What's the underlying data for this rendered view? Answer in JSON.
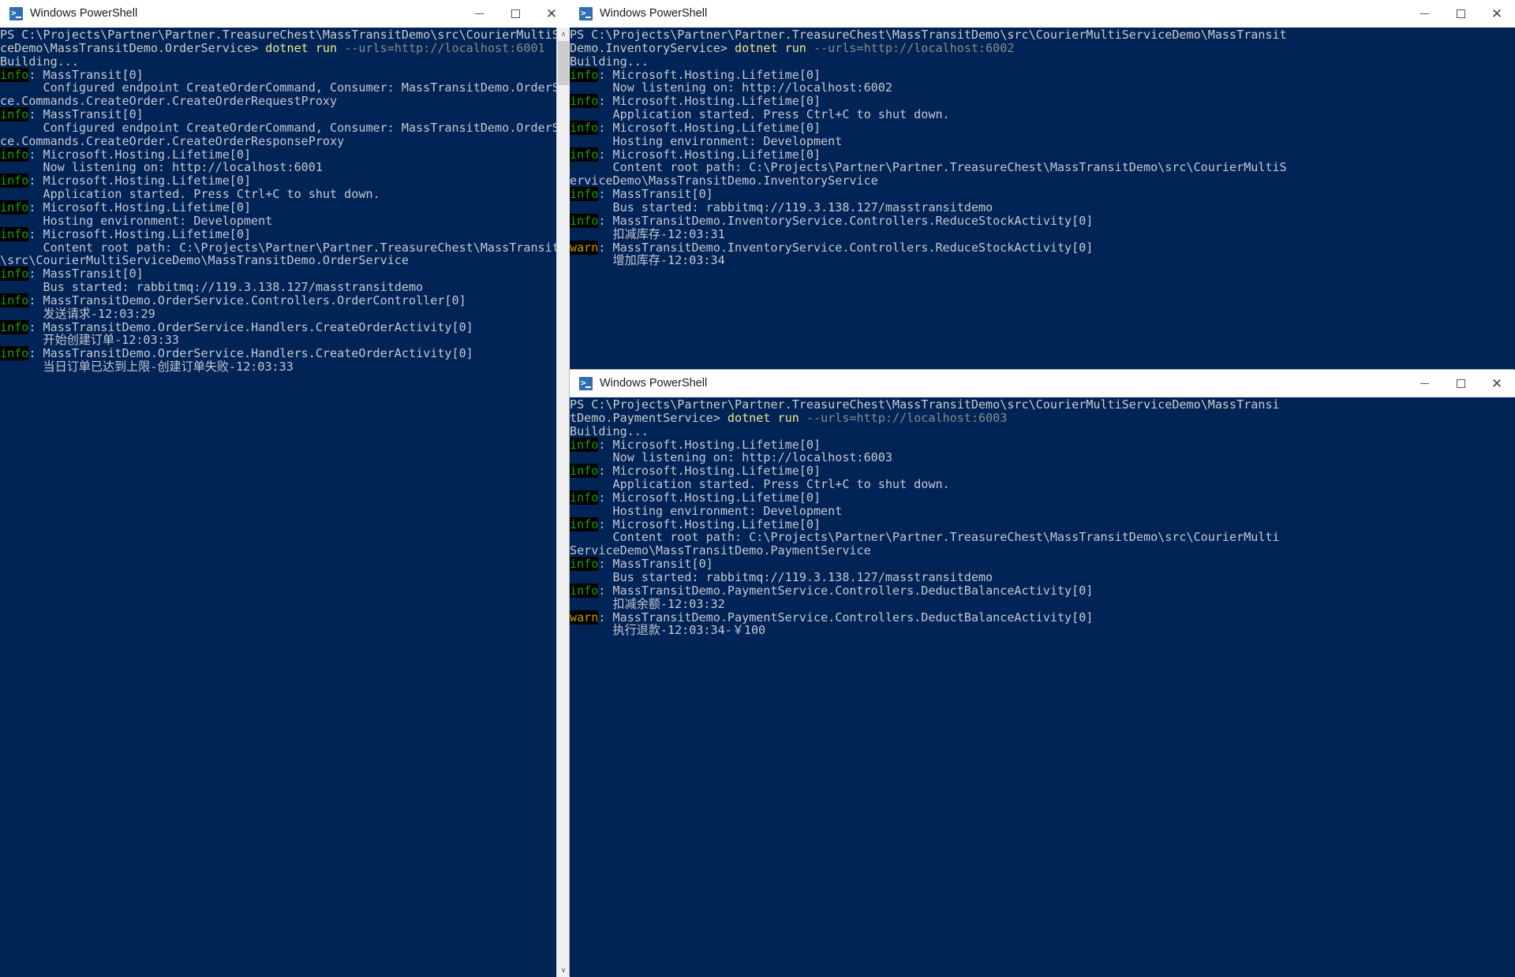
{
  "desktop": {
    "background_color": "#002050"
  },
  "windows": [
    {
      "id": "order-service",
      "title": "Windows PowerShell",
      "icon": "powershell-icon",
      "controls": {
        "minimize": "—",
        "maximize": "□",
        "close": "✕"
      },
      "scrollbar": {
        "up_arrow": "∧",
        "down_arrow": "∨"
      },
      "lines": [
        [
          {
            "t": "PS C:\\Projects\\Partner\\Partner.TreasureChest\\MassTransitDemo\\src\\CourierMultiServi",
            "c": "default"
          }
        ],
        [
          {
            "t": "ceDemo\\MassTransitDemo.OrderService> ",
            "c": "default"
          },
          {
            "t": "dotnet run ",
            "c": "cmd"
          },
          {
            "t": "--urls=http://localhost:6001",
            "c": "arg"
          }
        ],
        [
          {
            "t": "Building...",
            "c": "default"
          }
        ],
        [
          {
            "t": "info",
            "c": "info"
          },
          {
            "t": ": MassTransit[0]",
            "c": "body"
          }
        ],
        [
          {
            "t": "      Configured endpoint CreateOrderCommand, Consumer: MassTransitDemo.OrderServi",
            "c": "body"
          }
        ],
        [
          {
            "t": "ce.Commands.CreateOrder.CreateOrderRequestProxy",
            "c": "body"
          }
        ],
        [
          {
            "t": "info",
            "c": "info"
          },
          {
            "t": ": MassTransit[0]",
            "c": "body"
          }
        ],
        [
          {
            "t": "      Configured endpoint CreateOrderCommand, Consumer: MassTransitDemo.OrderServi",
            "c": "body"
          }
        ],
        [
          {
            "t": "ce.Commands.CreateOrder.CreateOrderResponseProxy",
            "c": "body"
          }
        ],
        [
          {
            "t": "info",
            "c": "info"
          },
          {
            "t": ": Microsoft.Hosting.Lifetime[0]",
            "c": "body"
          }
        ],
        [
          {
            "t": "      Now listening on: http://localhost:6001",
            "c": "body"
          }
        ],
        [
          {
            "t": "info",
            "c": "info"
          },
          {
            "t": ": Microsoft.Hosting.Lifetime[0]",
            "c": "body"
          }
        ],
        [
          {
            "t": "      Application started. Press Ctrl+C to shut down.",
            "c": "body"
          }
        ],
        [
          {
            "t": "info",
            "c": "info"
          },
          {
            "t": ": Microsoft.Hosting.Lifetime[0]",
            "c": "body"
          }
        ],
        [
          {
            "t": "      Hosting environment: Development",
            "c": "body"
          }
        ],
        [
          {
            "t": "info",
            "c": "info"
          },
          {
            "t": ": Microsoft.Hosting.Lifetime[0]",
            "c": "body"
          }
        ],
        [
          {
            "t": "      Content root path: C:\\Projects\\Partner\\Partner.TreasureChest\\MassTransitDemo",
            "c": "body"
          }
        ],
        [
          {
            "t": "\\src\\CourierMultiServiceDemo\\MassTransitDemo.OrderService",
            "c": "body"
          }
        ],
        [
          {
            "t": "info",
            "c": "info"
          },
          {
            "t": ": MassTransit[0]",
            "c": "body"
          }
        ],
        [
          {
            "t": "      Bus started: rabbitmq://119.3.138.127/masstransitdemo",
            "c": "body"
          }
        ],
        [
          {
            "t": "info",
            "c": "info"
          },
          {
            "t": ": MassTransitDemo.OrderService.Controllers.OrderController[0]",
            "c": "body"
          }
        ],
        [
          {
            "t": "      发送请求-12:03:29",
            "c": "body"
          }
        ],
        [
          {
            "t": "info",
            "c": "info"
          },
          {
            "t": ": MassTransitDemo.OrderService.Handlers.CreateOrderActivity[0]",
            "c": "body"
          }
        ],
        [
          {
            "t": "      开始创建订单-12:03:33",
            "c": "body"
          }
        ],
        [
          {
            "t": "info",
            "c": "info"
          },
          {
            "t": ": MassTransitDemo.OrderService.Handlers.CreateOrderActivity[0]",
            "c": "body"
          }
        ],
        [
          {
            "t": "      当日订单已达到上限-创建订单失败-12:03:33",
            "c": "body"
          }
        ]
      ]
    },
    {
      "id": "inventory-service",
      "title": "Windows PowerShell",
      "icon": "powershell-icon",
      "controls": {
        "minimize": "—",
        "maximize": "□",
        "close": "✕"
      },
      "lines": [
        [
          {
            "t": "PS C:\\Projects\\Partner\\Partner.TreasureChest\\MassTransitDemo\\src\\CourierMultiServiceDemo\\MassTransit",
            "c": "default"
          }
        ],
        [
          {
            "t": "Demo.InventoryService> ",
            "c": "default"
          },
          {
            "t": "dotnet run ",
            "c": "cmd"
          },
          {
            "t": "--urls=http://localhost:6002",
            "c": "arg"
          }
        ],
        [
          {
            "t": "Building...",
            "c": "default"
          }
        ],
        [
          {
            "t": "info",
            "c": "info"
          },
          {
            "t": ": Microsoft.Hosting.Lifetime[0]",
            "c": "body"
          }
        ],
        [
          {
            "t": "      Now listening on: http://localhost:6002",
            "c": "body"
          }
        ],
        [
          {
            "t": "info",
            "c": "info"
          },
          {
            "t": ": Microsoft.Hosting.Lifetime[0]",
            "c": "body"
          }
        ],
        [
          {
            "t": "      Application started. Press Ctrl+C to shut down.",
            "c": "body"
          }
        ],
        [
          {
            "t": "info",
            "c": "info"
          },
          {
            "t": ": Microsoft.Hosting.Lifetime[0]",
            "c": "body"
          }
        ],
        [
          {
            "t": "      Hosting environment: Development",
            "c": "body"
          }
        ],
        [
          {
            "t": "info",
            "c": "info"
          },
          {
            "t": ": Microsoft.Hosting.Lifetime[0]",
            "c": "body"
          }
        ],
        [
          {
            "t": "      Content root path: C:\\Projects\\Partner\\Partner.TreasureChest\\MassTransitDemo\\src\\CourierMultiS",
            "c": "body"
          }
        ],
        [
          {
            "t": "erviceDemo\\MassTransitDemo.InventoryService",
            "c": "body"
          }
        ],
        [
          {
            "t": "info",
            "c": "info"
          },
          {
            "t": ": MassTransit[0]",
            "c": "body"
          }
        ],
        [
          {
            "t": "      Bus started: rabbitmq://119.3.138.127/masstransitdemo",
            "c": "body"
          }
        ],
        [
          {
            "t": "info",
            "c": "info"
          },
          {
            "t": ": MassTransitDemo.InventoryService.Controllers.ReduceStockActivity[0]",
            "c": "body"
          }
        ],
        [
          {
            "t": "      扣减库存-12:03:31",
            "c": "body"
          }
        ],
        [
          {
            "t": "warn",
            "c": "warn"
          },
          {
            "t": ": MassTransitDemo.InventoryService.Controllers.ReduceStockActivity[0]",
            "c": "body"
          }
        ],
        [
          {
            "t": "      增加库存-12:03:34",
            "c": "body"
          }
        ]
      ]
    },
    {
      "id": "payment-service",
      "title": "Windows PowerShell",
      "icon": "powershell-icon",
      "controls": {
        "minimize": "—",
        "maximize": "□",
        "close": "✕"
      },
      "lines": [
        [
          {
            "t": "PS C:\\Projects\\Partner\\Partner.TreasureChest\\MassTransitDemo\\src\\CourierMultiServiceDemo\\MassTransi",
            "c": "default"
          }
        ],
        [
          {
            "t": "tDemo.PaymentService> ",
            "c": "default"
          },
          {
            "t": "dotnet run ",
            "c": "cmd"
          },
          {
            "t": "--urls=http://localhost:6003",
            "c": "arg"
          }
        ],
        [
          {
            "t": "Building...",
            "c": "default"
          }
        ],
        [
          {
            "t": "info",
            "c": "info"
          },
          {
            "t": ": Microsoft.Hosting.Lifetime[0]",
            "c": "body"
          }
        ],
        [
          {
            "t": "      Now listening on: http://localhost:6003",
            "c": "body"
          }
        ],
        [
          {
            "t": "info",
            "c": "info"
          },
          {
            "t": ": Microsoft.Hosting.Lifetime[0]",
            "c": "body"
          }
        ],
        [
          {
            "t": "      Application started. Press Ctrl+C to shut down.",
            "c": "body"
          }
        ],
        [
          {
            "t": "info",
            "c": "info"
          },
          {
            "t": ": Microsoft.Hosting.Lifetime[0]",
            "c": "body"
          }
        ],
        [
          {
            "t": "      Hosting environment: Development",
            "c": "body"
          }
        ],
        [
          {
            "t": "info",
            "c": "info"
          },
          {
            "t": ": Microsoft.Hosting.Lifetime[0]",
            "c": "body"
          }
        ],
        [
          {
            "t": "      Content root path: C:\\Projects\\Partner\\Partner.TreasureChest\\MassTransitDemo\\src\\CourierMulti",
            "c": "body"
          }
        ],
        [
          {
            "t": "ServiceDemo\\MassTransitDemo.PaymentService",
            "c": "body"
          }
        ],
        [
          {
            "t": "info",
            "c": "info"
          },
          {
            "t": ": MassTransit[0]",
            "c": "body"
          }
        ],
        [
          {
            "t": "      Bus started: rabbitmq://119.3.138.127/masstransitdemo",
            "c": "body"
          }
        ],
        [
          {
            "t": "info",
            "c": "info"
          },
          {
            "t": ": MassTransitDemo.PaymentService.Controllers.DeductBalanceActivity[0]",
            "c": "body"
          }
        ],
        [
          {
            "t": "      扣减余额-12:03:32",
            "c": "body"
          }
        ],
        [
          {
            "t": "warn",
            "c": "warn"
          },
          {
            "t": ": MassTransitDemo.PaymentService.Controllers.DeductBalanceActivity[0]",
            "c": "body"
          }
        ],
        [
          {
            "t": "      执行退款-12:03:34-￥100",
            "c": "body"
          }
        ]
      ]
    }
  ],
  "colors": {
    "console_background": "#012456",
    "info_green": "#13a10e",
    "warn_yellow": "#c19c00",
    "command_yellow": "#f0e68c",
    "text_grey": "#c7c7d5"
  }
}
